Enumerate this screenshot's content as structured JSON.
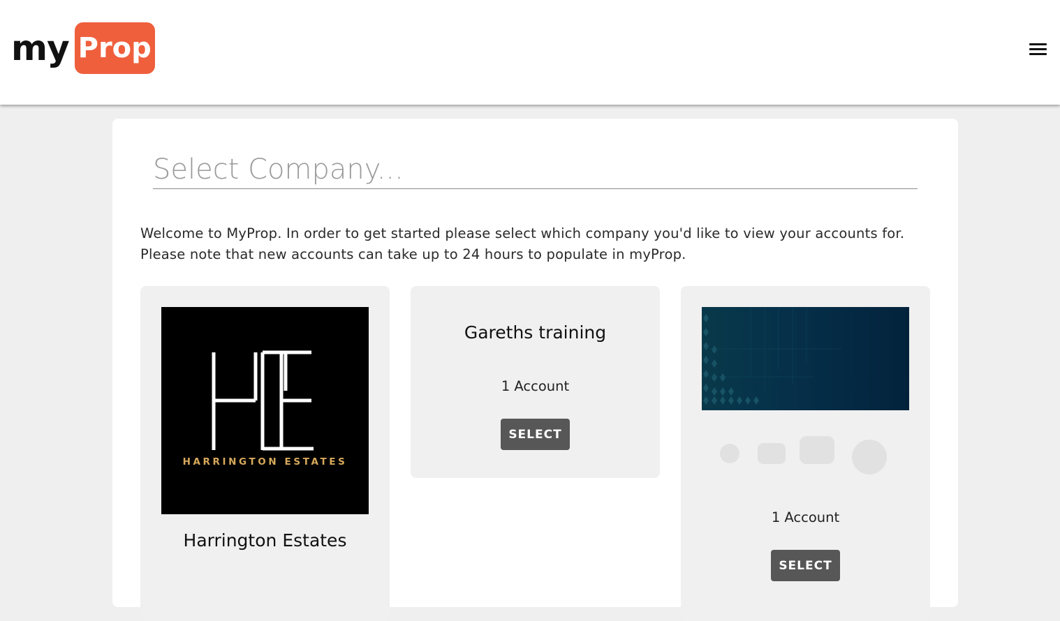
{
  "header": {
    "logo_my": "my",
    "logo_prop": "Prop",
    "colors": {
      "brand": "#ef5f3c"
    }
  },
  "search": {
    "placeholder": "Select Company..."
  },
  "welcome": {
    "text": "Welcome to MyProp. In order to get started please select which company you'd like to view your accounts for. Please note that new accounts can take up to 24 hours to populate in myProp."
  },
  "companies": [
    {
      "logo_text": "HARRINGTON ESTATES",
      "name": "Harrington Estates"
    },
    {
      "name": "Gareths training",
      "accounts": "1 Account",
      "select_label": "SELECT"
    },
    {
      "accounts": "1 Account",
      "select_label": "SELECT"
    }
  ],
  "icons": [
    "hamburger-menu-icon"
  ]
}
